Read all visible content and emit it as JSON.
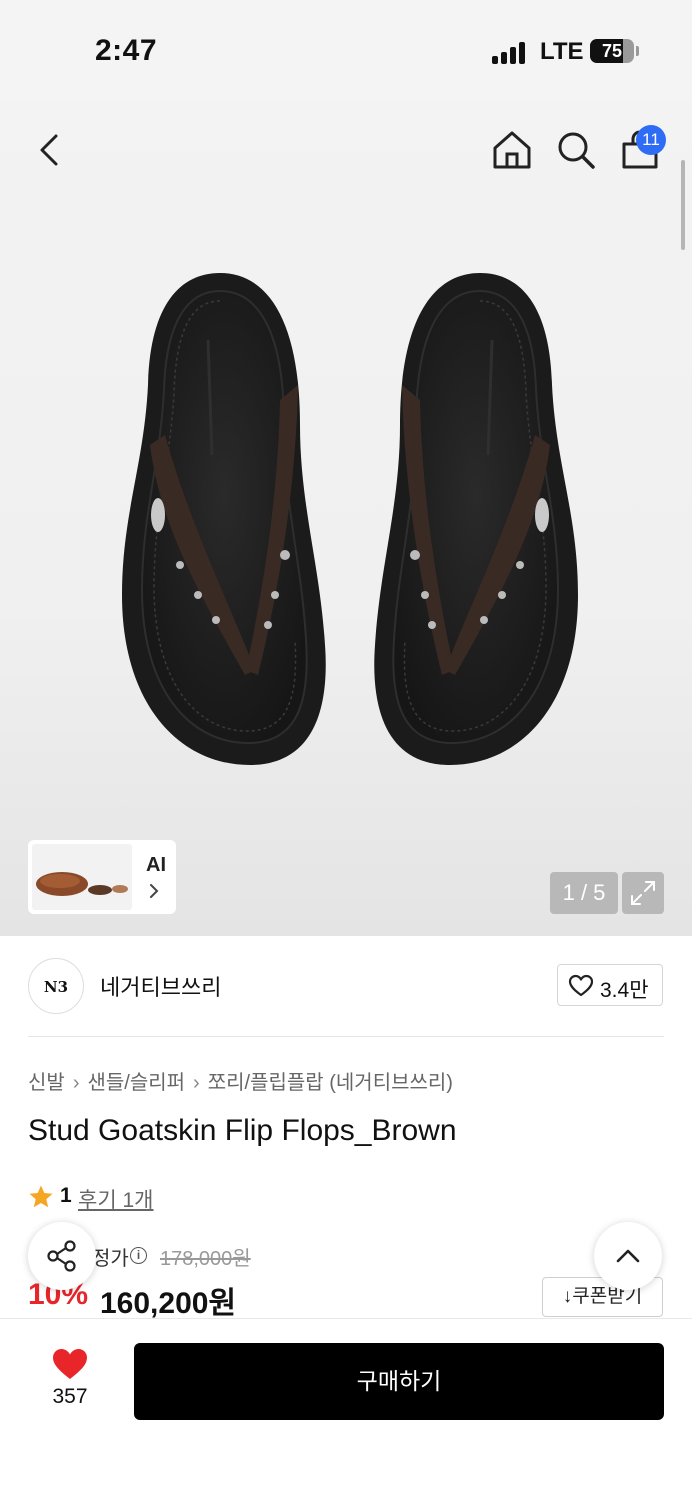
{
  "status_bar": {
    "time": "2:47",
    "network": "LTE",
    "battery": "75",
    "battery_level": 0.75
  },
  "nav": {
    "cart_badge": "11"
  },
  "gallery": {
    "ai_label": "AI",
    "counter": "1 / 5"
  },
  "brand": {
    "logo_text": "N3",
    "name": "네거티브쓰리",
    "likes": "3.4만"
  },
  "breadcrumb": [
    "신발",
    "샌들/슬리퍼",
    "쪼리/플립플랍 (네거티브쓰리)"
  ],
  "product": {
    "title": "Stud Goatskin Flip Flops_Brown"
  },
  "rating": {
    "score": "1",
    "review_link": "후기 1개"
  },
  "price": {
    "label": "정가",
    "original": "178,000원",
    "discount": "10%",
    "sale": "160,200원",
    "coupon_label": "↓쿠폰받기"
  },
  "bottom_bar": {
    "wish_count": "357",
    "buy_label": "구매하기"
  },
  "colors": {
    "accent_blue": "#2f6cf5",
    "discount_red": "#e8262a",
    "heart_red": "#e8262a",
    "buy_button": "#000000"
  }
}
